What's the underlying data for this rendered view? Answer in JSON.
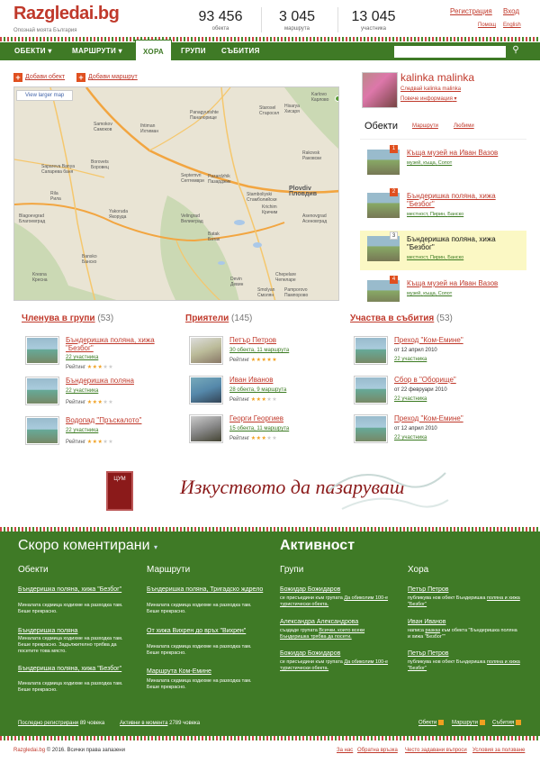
{
  "header": {
    "logo": "Razgledai.bg",
    "tagline": "Опознай моята България",
    "stats": [
      {
        "value": "93 456",
        "label": "обекта"
      },
      {
        "value": "3 045",
        "label": "маршрута"
      },
      {
        "value": "13 045",
        "label": "участника"
      }
    ],
    "register": "Регистрация",
    "login": "Вход",
    "help": "Помощ",
    "lang": "English"
  },
  "nav": {
    "items": [
      "ОБЕКТИ",
      "МАРШРУТИ",
      "ХОРА",
      "ГРУПИ",
      "СЪБИТИЯ"
    ],
    "active": "ХОРА",
    "search_placeholder": ""
  },
  "actions": {
    "add_object": "Добави обект",
    "add_route": "Добави маршрут"
  },
  "map": {
    "larger_map": "View larger map",
    "cities": [
      "Samokov",
      "Самоков",
      "Ihtiman",
      "Ихтиман",
      "Panagyurishte",
      "Панагюрище",
      "Starosel",
      "Старосел",
      "Hisarya",
      "Хисаря",
      "Karlovo",
      "Карлово",
      "Borovets",
      "Боровец",
      "Pazardzhik",
      "Пазарджик",
      "Plovdiv",
      "Пловдив",
      "Velingrad",
      "Велинград",
      "Asenovgrad",
      "Асеновград",
      "Blagoevgrad",
      "Благоевград",
      "Bansko",
      "Банско",
      "Devin",
      "Девин",
      "Smolyan",
      "Смолян",
      "Chepelare",
      "Чепеларе",
      "Pamporovo",
      "Пампорово",
      "Batak",
      "Батак",
      "Krichim",
      "Кричим",
      "Yakoruda",
      "Якоруда",
      "Sapareva Banya",
      "Сапарева баня",
      "Rila",
      "Рила",
      "Septemvri",
      "Септември",
      "Stamboliyski",
      "Стамболийски",
      "Rakovsk",
      "Раковски",
      "Kresna",
      "Кресна"
    ]
  },
  "profile": {
    "name": "kalinka malinka",
    "follow": "Следвай kalinka malinka",
    "more": "Повече информация",
    "tabs": [
      "Обекти",
      "Маршрути",
      "Любими"
    ],
    "objects": [
      {
        "num": "1",
        "title": "Къща музей на Иван Вазов",
        "tags": [
          "музей",
          "къща",
          "Сопот"
        ]
      },
      {
        "num": "2",
        "title": "Бъндеришка поляна, хижа \"Безбог\"",
        "tags": [
          "местност",
          "Пирин",
          "Банско"
        ]
      },
      {
        "num": "3",
        "title": "Бъндеришка поляна, хижа \"Безбог\"",
        "tags": [
          "местност",
          "Пирин",
          "Банско"
        ]
      },
      {
        "num": "4",
        "title": "Къща музей на Иван Вазов",
        "tags": [
          "музей",
          "къща",
          "Сопот"
        ]
      }
    ]
  },
  "groups": {
    "title": "Членува в групи",
    "count": "(53)",
    "rating_label": "Рейтинг",
    "items": [
      {
        "title": "Бъндеришка поляна, хижа \"Безбог\"",
        "sub": "22 участника",
        "rating": 3
      },
      {
        "title": "Бъндеришка поляна",
        "sub": "22 участника",
        "rating": 3
      },
      {
        "title": "Водопад \"Пръскалото\"",
        "sub": "22 участника",
        "rating": 3
      }
    ]
  },
  "friends": {
    "title": "Приятели",
    "count": "(145)",
    "rating_label": "Рейтинг",
    "items": [
      {
        "title": "Петър Петров",
        "sub": "30 обекта, 11 маршрута",
        "rating": 5
      },
      {
        "title": "Иван Иванов",
        "sub": "28 обекта, 9 маршрута",
        "rating": 3
      },
      {
        "title": "Георги Георгиев",
        "sub": "15 обекта, 11 маршрута",
        "rating": 3
      }
    ]
  },
  "events": {
    "title": "Участва в събития",
    "count": "(53)",
    "items": [
      {
        "title": "Преход \"Ком-Емине\"",
        "date": "от 12 април 2010",
        "sub": "22 участника"
      },
      {
        "title": "Сбор в \"Оборище\"",
        "date": "от 22 февруари 2010",
        "sub": "22 участника"
      },
      {
        "title": "Преход \"Ком-Емине\"",
        "date": "от 12 април 2010",
        "sub": "22 участника"
      }
    ]
  },
  "ad": {
    "logo_text": "ЦУМ",
    "slogan": "Изкуството да пазаруваш"
  },
  "footer": {
    "recent_title": "Скоро коментирани",
    "activity_title": "Активност",
    "cols": [
      "Обекти",
      "Маршрути",
      "Групи",
      "Хора"
    ],
    "objects": [
      {
        "title": "Бъндеришка поляна, хижа \"Безбог\"",
        "text": "Миналата седмица ходихме на разходка там. Беше прекрасно."
      },
      {
        "title": "Бъндеришка поляна",
        "text": "Миналата седмица ходихме на разходка там. Беше прекрасно. Задължително трябва да посетите това място."
      },
      {
        "title": "Бъндеришка поляна, хижа \"Безбог\"",
        "text": "Миналата седмица ходихме на разходка там. Беше прекрасно."
      }
    ],
    "routes": [
      {
        "title": "Бъндеришка поляна, Тригадско ждрело",
        "text": "Миналата седмица ходихме на разходка там. Беше прекрасно."
      },
      {
        "title": "От хижа Вихрен до връх \"Вихрен\"",
        "text": "Миналата седмица ходихме на разходка там. Беше прекрасно."
      },
      {
        "title": "Маршрута Ком-Емине",
        "text": "Миналата седмица ходихме на разходка там. Беше прекрасно."
      }
    ],
    "groups": [
      {
        "name": "Божидар Божидаров",
        "pre": "се присъедини към групата",
        "link": "Да обиколим 100-е туристически обекта."
      },
      {
        "name": "Александра Александрова",
        "pre": "създаде групата",
        "link": "Всички, които всеки Бъндеришка трябва да посети."
      },
      {
        "name": "Божидар Божидаров",
        "pre": "се присъедини към групата",
        "link": "Да обиколим 100-е туристически обекта."
      }
    ],
    "people": [
      {
        "name": "Петър Петров",
        "pre": "публикува нов обект Бъндеришка",
        "link": "поляна и хижа \"Безбог\""
      },
      {
        "name": "Иван Иванов",
        "pre": "написа",
        "link": "разказ",
        "post": "към обекта \"Бъндеришка поляна и хижа \"Безбог\"\""
      },
      {
        "name": "Петър Петров",
        "pre": "публикува нов обект Бъндеришка",
        "link": "поляна и хижа \"Безбог\""
      }
    ],
    "recent_reg": "Последно регистрирани",
    "recent_reg_count": "89 човека",
    "active_now": "Активни в момента",
    "active_now_count": "2789 човека",
    "feed_objects": "Обекти",
    "feed_routes": "Маршрути",
    "feed_events": "Събития"
  },
  "bottom": {
    "site": "Razgledai.bg",
    "copyright": "© 2016. Всички права запазени",
    "links": [
      "За нас",
      "Обратна връзка",
      "Често задавани въпроси",
      "Условия за ползване"
    ]
  },
  "colors": {
    "brand_red": "#c0392b",
    "brand_green": "#3f7a26"
  }
}
